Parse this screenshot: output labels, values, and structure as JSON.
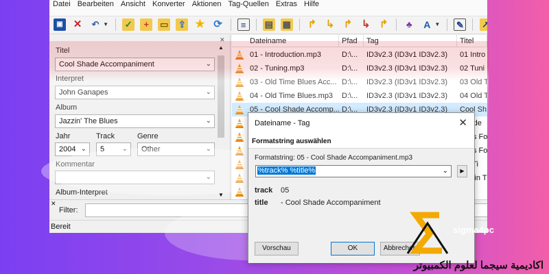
{
  "menu": [
    "Datei",
    "Bearbeiten",
    "Ansicht",
    "Konverter",
    "Aktionen",
    "Tag-Quellen",
    "Extras",
    "Hilfe"
  ],
  "toolbar": {
    "icons": [
      "save-icon",
      "remove-icon",
      "undo-icon",
      "check-tag-icon",
      "add-folder-icon",
      "open-folder-icon",
      "export-icon",
      "favorite-star-icon",
      "refresh-icon",
      "list-icon",
      "clipboard-icon",
      "print-icon",
      "tag-convert-icon",
      "tag-convert-icon",
      "tag-convert-icon",
      "tag-convert-icon",
      "tag-convert-icon",
      "scripts-icon",
      "case-conversion-icon",
      "edit-icon",
      "export-list-icon",
      "playlist-icon",
      "playlist-icon",
      "playlist-icon",
      "playlist-icon"
    ]
  },
  "tagpanel": {
    "title_label": "Titel",
    "title_value": "Cool Shade Accompaniment",
    "artist_label": "Interpret",
    "artist_value": "John Ganapes",
    "album_label": "Album",
    "album_value": "Jazzin' The Blues",
    "year_label": "Jahr",
    "year_value": "2004",
    "track_label": "Track",
    "track_value": "5",
    "genre_label": "Genre",
    "genre_value": "Other",
    "comment_label": "Kommentar",
    "comment_value": "",
    "album_artist_label": "Album-Interpret"
  },
  "filelist": {
    "columns": [
      "Dateiname",
      "Pfad",
      "Tag",
      "Titel"
    ],
    "rows": [
      {
        "name": "01 - Introduction.mp3",
        "path": "D:\\...",
        "tag": "ID3v2.3 (ID3v1 ID3v2.3)",
        "title": "01 Intro"
      },
      {
        "name": "02 - Tuning.mp3",
        "path": "D:\\...",
        "tag": "ID3v2.3 (ID3v1 ID3v2.3)",
        "title": "02 Tuni"
      },
      {
        "name": "03 - Old Time Blues Acc...",
        "path": "D:\\...",
        "tag": "ID3v2.3 (ID3v1 ID3v2.3)",
        "title": "03 Old T"
      },
      {
        "name": "04 - Old Time Blues.mp3",
        "path": "D:\\...",
        "tag": "ID3v2.3 (ID3v1 ID3v2.3)",
        "title": "04 Old T"
      },
      {
        "name": "05 - Cool Shade Accomp...",
        "path": "D:\\...",
        "tag": "ID3v2.3 (ID3v1 ID3v2.3)",
        "title": "Cool Sh"
      },
      {
        "name": "",
        "path": "",
        "tag": "",
        "title": "Shade"
      },
      {
        "name": "",
        "path": "",
        "tag": "",
        "title": "Fees Fo"
      },
      {
        "name": "",
        "path": "",
        "tag": "",
        "title": "Fees Fo"
      },
      {
        "name": "",
        "path": "",
        "tag": "",
        "title": "Fin Ti"
      },
      {
        "name": "",
        "path": "",
        "tag": "",
        "title": "10 Tin T"
      },
      {
        "name": "",
        "path": "",
        "tag": "",
        "title": "Too"
      },
      {
        "name": "",
        "path": "",
        "tag": "",
        "title": ""
      }
    ]
  },
  "filter": {
    "label": "Filter:",
    "value": ""
  },
  "status": "Bereit",
  "dialog": {
    "title": "Dateiname - Tag",
    "close": "✕",
    "heading": "Formatstring auswählen",
    "preview_line": "Formatstring: 05 - Cool Shade Accompaniment.mp3",
    "format_value": "%track% %title%",
    "result": [
      {
        "key": "track",
        "value": "05"
      },
      {
        "key": "title",
        "value": "- Cool Shade Accompaniment"
      }
    ],
    "preview_button": "Vorschau",
    "ok_button": "OK",
    "cancel_button": "Abbrechen"
  },
  "watermark": {
    "brand": "sigma4pc",
    "arabic": "اكاديمية سيجما لعلوم الكمبيوتر"
  },
  "colors": {
    "selection": "#cce8ff",
    "accent": "#0078d7",
    "logo": "#f2a900"
  }
}
